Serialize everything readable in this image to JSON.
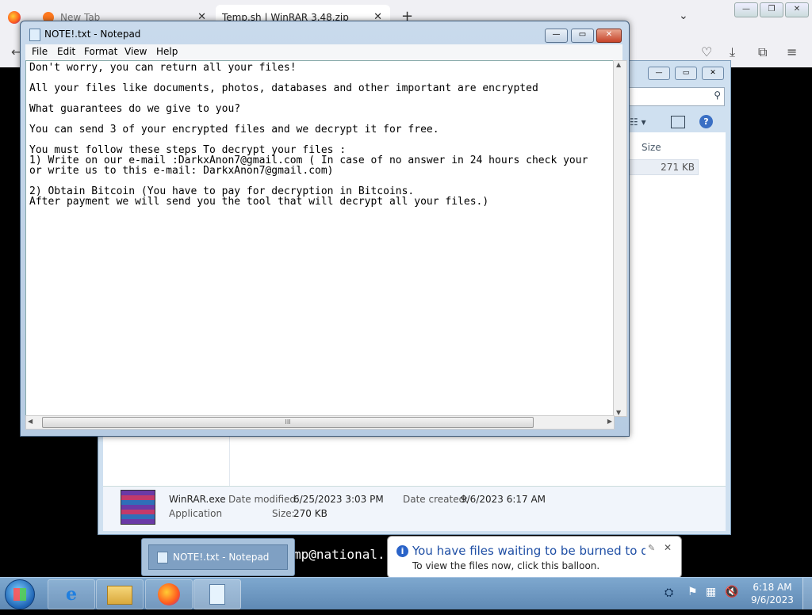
{
  "browser": {
    "tabs": [
      {
        "label": "New Tab"
      },
      {
        "label": "Temp.sh | WinRAR 3.48.zip"
      }
    ],
    "new_tab_symbol": "+",
    "close_symbol": "✕"
  },
  "terminal": {
    "fragment": "mp@national."
  },
  "explorer": {
    "column_size_header": "Size",
    "row_size": "271 KB",
    "details": {
      "file_name": "WinRAR.exe",
      "file_type": "Application",
      "date_modified_label": "Date modified:",
      "date_modified_value": "6/25/2023 3:03 PM",
      "date_created_label": "Date created:",
      "date_created_value": "9/6/2023 6:17 AM",
      "size_label": "Size:",
      "size_value": "270 KB"
    }
  },
  "notepad": {
    "title": "NOTE!.txt - Notepad",
    "menu": [
      "File",
      "Edit",
      "Format",
      "View",
      "Help"
    ],
    "lines": [
      "Don't worry, you can return all your files!",
      "All your files like documents, photos, databases and other important are encrypted",
      "What guarantees do we give to you?",
      "You can send 3 of your encrypted files and we decrypt it for free.",
      "You must follow these steps To decrypt your files :",
      "1) Write on our e-mail :DarkxAnon7@gmail.com ( In case of no answer in 24 hours check your",
      "or write us to this e-mail: DarkxAnon7@gmail.com)",
      "2) Obtain Bitcoin (You have to pay for decryption in Bitcoins.",
      "After payment we will send you the tool that will decrypt all your files.)"
    ],
    "scroll_grip": "III"
  },
  "taskbar": {
    "preview_label": "NOTE!.txt - Notepad",
    "time": "6:18 AM",
    "date": "9/6/2023"
  },
  "balloon": {
    "title": "You have files waiting to be burned to disc",
    "body": "To view the files now, click this balloon."
  }
}
